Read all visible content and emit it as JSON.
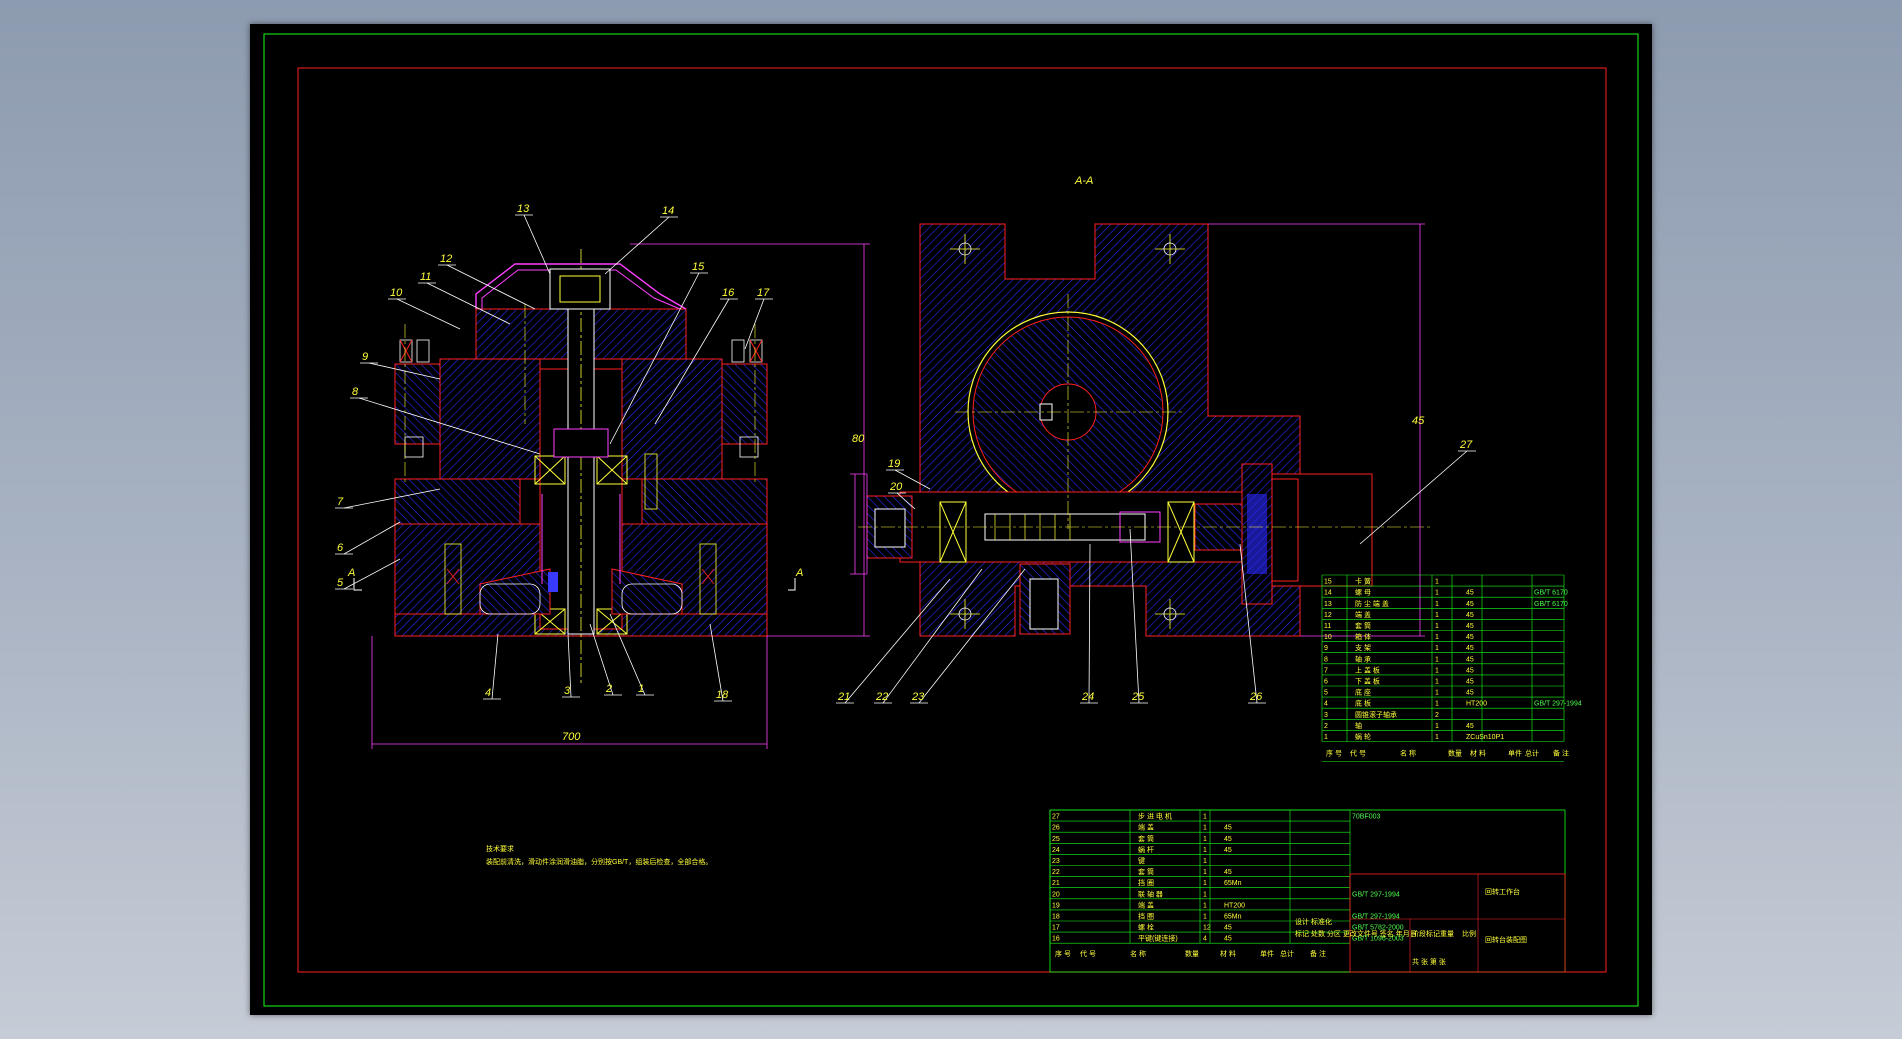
{
  "colors": {
    "green": "#19ff19",
    "red": "#ff2020",
    "magenta": "#ff40ff",
    "yellow": "#ffff3a",
    "blue": "#3a3aff",
    "cyan": "#40ffff",
    "white": "#ffffff"
  },
  "left_labels": [
    "1",
    "2",
    "3",
    "4",
    "5",
    "6",
    "7",
    "8",
    "9",
    "10",
    "11",
    "12",
    "13",
    "14",
    "15",
    "16",
    "17",
    "18"
  ],
  "right_labels": [
    "19",
    "20",
    "21",
    "22",
    "23",
    "24",
    "25",
    "26",
    "27"
  ],
  "section_title": "A-A",
  "section_marks": [
    "A",
    "A"
  ],
  "notes": {
    "title": "技术要求",
    "body": "装配前清洗，滑动件涂润滑油脂，分别按GB/T，组装后检查，全部合格。"
  },
  "dimension_labels": {
    "bottom_width": "700",
    "height_left": "80",
    "height_right": "45"
  },
  "parts_right": [
    {
      "no": "15",
      "name": "卡  簧",
      "qty": "1",
      "mat": "",
      "std": ""
    },
    {
      "no": "14",
      "name": "螺  母",
      "qty": "1",
      "mat": "45",
      "std": "GB/T 6170"
    },
    {
      "no": "13",
      "name": "防 尘 端 盖",
      "qty": "1",
      "mat": "45",
      "std": "GB/T 6170"
    },
    {
      "no": "12",
      "name": "端  盖",
      "qty": "1",
      "mat": "45",
      "std": ""
    },
    {
      "no": "11",
      "name": "套  筒",
      "qty": "1",
      "mat": "45",
      "std": ""
    },
    {
      "no": "10",
      "name": "箱  体",
      "qty": "1",
      "mat": "45",
      "std": ""
    },
    {
      "no": "9",
      "name": "支  架",
      "qty": "1",
      "mat": "45",
      "std": ""
    },
    {
      "no": "8",
      "name": "轴  承",
      "qty": "1",
      "mat": "45",
      "std": ""
    },
    {
      "no": "7",
      "name": "上 盖 板",
      "qty": "1",
      "mat": "45",
      "std": ""
    },
    {
      "no": "6",
      "name": "下 盖 板",
      "qty": "1",
      "mat": "45",
      "std": ""
    },
    {
      "no": "5",
      "name": "底  座",
      "qty": "1",
      "mat": "45",
      "std": ""
    },
    {
      "no": "4",
      "name": "底  板",
      "qty": "1",
      "mat": "HT200",
      "std": "GB/T 297-1994"
    },
    {
      "no": "3",
      "name": "圆锥滚子轴承",
      "qty": "2",
      "mat": "",
      "std": ""
    },
    {
      "no": "2",
      "name": "轴",
      "qty": "1",
      "mat": "45",
      "std": ""
    },
    {
      "no": "1",
      "name": "蜗  轮",
      "qty": "1",
      "mat": "ZCuSn10P1",
      "std": ""
    }
  ],
  "parts_left": [
    {
      "no": "27",
      "name": "步 进 电 机",
      "qty": "1",
      "mat": "",
      "std": "70BF003"
    },
    {
      "no": "26",
      "name": "端  盖",
      "qty": "1",
      "mat": "45",
      "std": ""
    },
    {
      "no": "25",
      "name": "套  筒",
      "qty": "1",
      "mat": "45",
      "std": ""
    },
    {
      "no": "24",
      "name": "蜗  杆",
      "qty": "1",
      "mat": "45",
      "std": ""
    },
    {
      "no": "23",
      "name": "键",
      "qty": "1",
      "mat": "",
      "std": ""
    },
    {
      "no": "22",
      "name": "套  筒",
      "qty": "1",
      "mat": "45",
      "std": ""
    },
    {
      "no": "21",
      "name": "挡  圈",
      "qty": "1",
      "mat": "65Mn",
      "std": ""
    },
    {
      "no": "20",
      "name": "联 轴 器",
      "qty": "1",
      "mat": "",
      "std": "GB/T 297-1994"
    },
    {
      "no": "19",
      "name": "端  盖",
      "qty": "1",
      "mat": "HT200",
      "std": ""
    },
    {
      "no": "18",
      "name": "挡  圈",
      "qty": "1",
      "mat": "65Mn",
      "std": "GB/T 297-1994"
    },
    {
      "no": "17",
      "name": "螺  栓",
      "qty": "12",
      "mat": "45",
      "std": "GB/T 5782-2000"
    },
    {
      "no": "16",
      "name": "平键(键连接)",
      "qty": "4",
      "mat": "45",
      "std": "GB/T 1096-2003"
    }
  ],
  "header_cols": [
    "序 号",
    "代  号",
    "名  称",
    "数量",
    "材  料",
    "单件",
    "总计",
    "备 注"
  ],
  "title_block": {
    "org": "回转工作台",
    "drawing": "回转台装配图",
    "weight_label": "重量",
    "scale_label": "比例",
    "stage_label": "阶段标记",
    "sheet": "共 张  第 张",
    "designer_row": "设计  标准化",
    "date_row": "标记 处数 分区 更改文件号 签名 年月日"
  }
}
